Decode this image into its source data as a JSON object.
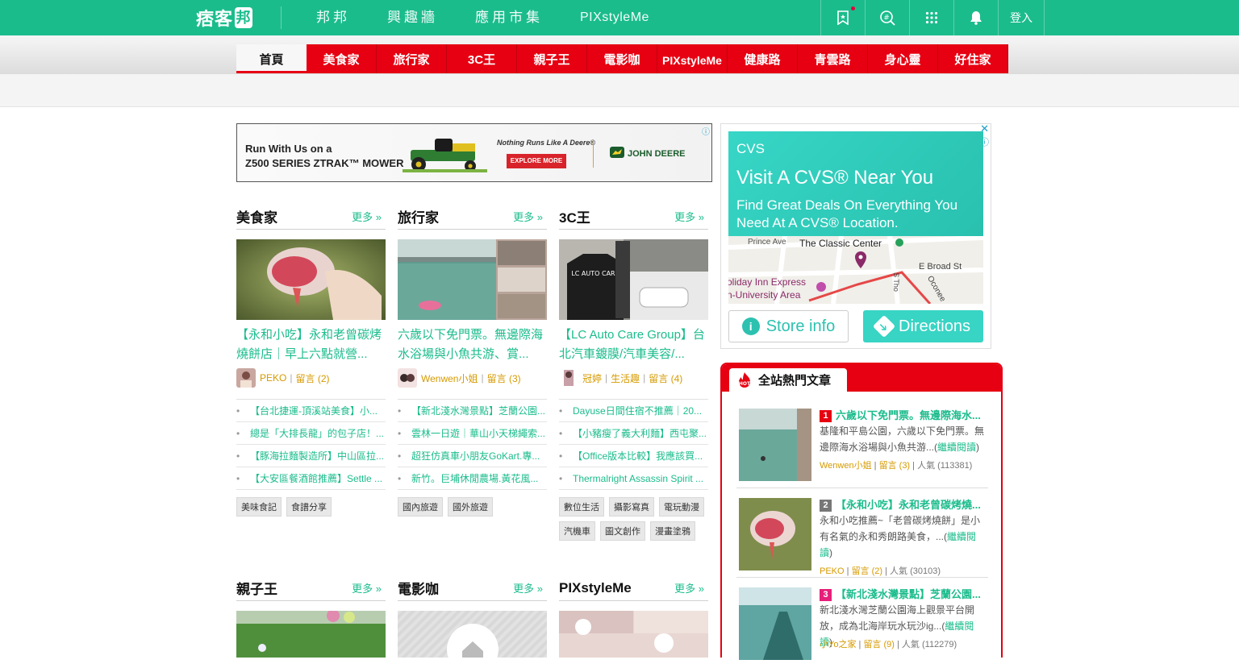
{
  "header": {
    "logo_text": "痞客",
    "logo_mark": "邦",
    "nav": [
      "邦邦",
      "興趣牆",
      "應用市集",
      "PIXstyleMe"
    ],
    "login": "登入"
  },
  "category_tabs": [
    "首頁",
    "美食家",
    "旅行家",
    "3C王",
    "親子王",
    "電影咖",
    "PIXstyleMe",
    "健康路",
    "青雲路",
    "身心靈",
    "好住家"
  ],
  "ad_banner": {
    "line1": "Run With Us on a",
    "line2": "Z500 SERIES ZTRAK™ MOWER",
    "tagline": "Nothing Runs Like A Deere®",
    "cta": "EXPLORE MORE",
    "brand": "JOHN DEERE"
  },
  "sections": [
    {
      "title": "美食家",
      "more": "更多 »",
      "headline": "【永和小吃】永和老曾碳烤燒餅店｜早上六點就營...",
      "author": "PEKO",
      "comments": "留言 (2)",
      "category": "",
      "list": [
        "【台北捷運-頂溪站美食】小...",
        "總是「大排長龍」的包子店！...",
        "【豚海拉麵製造所】中山區拉...",
        "【大安區餐酒館推薦】Settle ..."
      ],
      "tags": [
        "美味食記",
        "食譜分享"
      ]
    },
    {
      "title": "旅行家",
      "more": "更多 »",
      "headline": "六歲以下免門票。無邊際海水浴場與小魚共游、賞...",
      "author": "Wenwen小姐",
      "comments": "留言 (3)",
      "category": "",
      "list": [
        "【新北淺水灣景點】芝蘭公園...",
        "雲林一日遊｜華山小天梯繩索...",
        "超狂仿真車小朋友GoKart.專...",
        "新竹。巨埔休閒農場.黃花風..."
      ],
      "tags": [
        "國內旅遊",
        "國外旅遊"
      ]
    },
    {
      "title": "3C王",
      "more": "更多 »",
      "headline": "【LC Auto Care Group】台北汽車鍍膜/汽車美容/...",
      "author": "冠婷",
      "comments": "留言 (4)",
      "category": "生活趣",
      "list": [
        "Dayuse日間住宿不推薦｜20...",
        "【小豬瘦了義大利麵】西屯聚...",
        "【Office版本比較】我應該買...",
        "Thermalright Assassin Spirit ..."
      ],
      "tags": [
        "數位生活",
        "攝影寫真",
        "電玩動漫",
        "汽機車",
        "圖文創作",
        "漫畫塗鴉"
      ]
    },
    {
      "title": "親子王",
      "more": "更多 »"
    },
    {
      "title": "電影咖",
      "more": "更多 »"
    },
    {
      "title": "PIXstyleMe",
      "more": "更多 »"
    }
  ],
  "right_ad": {
    "brand": "CVS",
    "heading": "Visit A CVS® Near You",
    "desc": "Find Great Deals On Everything You Need At A CVS® Location.",
    "map_labels": [
      "Prince Ave",
      "The Classic Center",
      "E Broad St",
      "oliday Inn Express",
      "n-University Area",
      "S Tho",
      "Oconee"
    ],
    "store_info": "Store info",
    "directions": "Directions",
    "close": "✕",
    "info": "ⓘ"
  },
  "hot": {
    "title": "全站熱門文章",
    "items": [
      {
        "num": "1",
        "title": "六歲以下免門票。無邊際海水...",
        "desc": "基隆和平島公園，六歲以下免門票。無邊際海水浴場與小魚共游...",
        "read_more": "繼續閱讀",
        "author": "Wenwen小姐",
        "comments": "留言 (3)",
        "popularity": "人氣 (113381)"
      },
      {
        "num": "2",
        "title": "【永和小吃】永和老曾碳烤燒...",
        "desc": "永和小吃推薦~「老曾碳烤燒餅」是小有名氣的永和秀朗路美食，...",
        "read_more": "繼續閱讀",
        "author": "PEKO",
        "comments": "留言 (2)",
        "popularity": "人氣 (30103)"
      },
      {
        "num": "3",
        "title": "【新北淺水灣景點】芝蘭公園...",
        "desc": "新北淺水灣芝蘭公園海上觀景平台開放，成為北海岸玩水玩沙ig...",
        "read_more": "繼續閱讀",
        "author": "小Yo之家",
        "comments": "留言 (9)",
        "popularity": "人氣 (112279)"
      }
    ]
  },
  "colors": {
    "brand_green": "#1bbc8c",
    "tab_red": "#e60012",
    "meta_gold": "#d69a00"
  }
}
